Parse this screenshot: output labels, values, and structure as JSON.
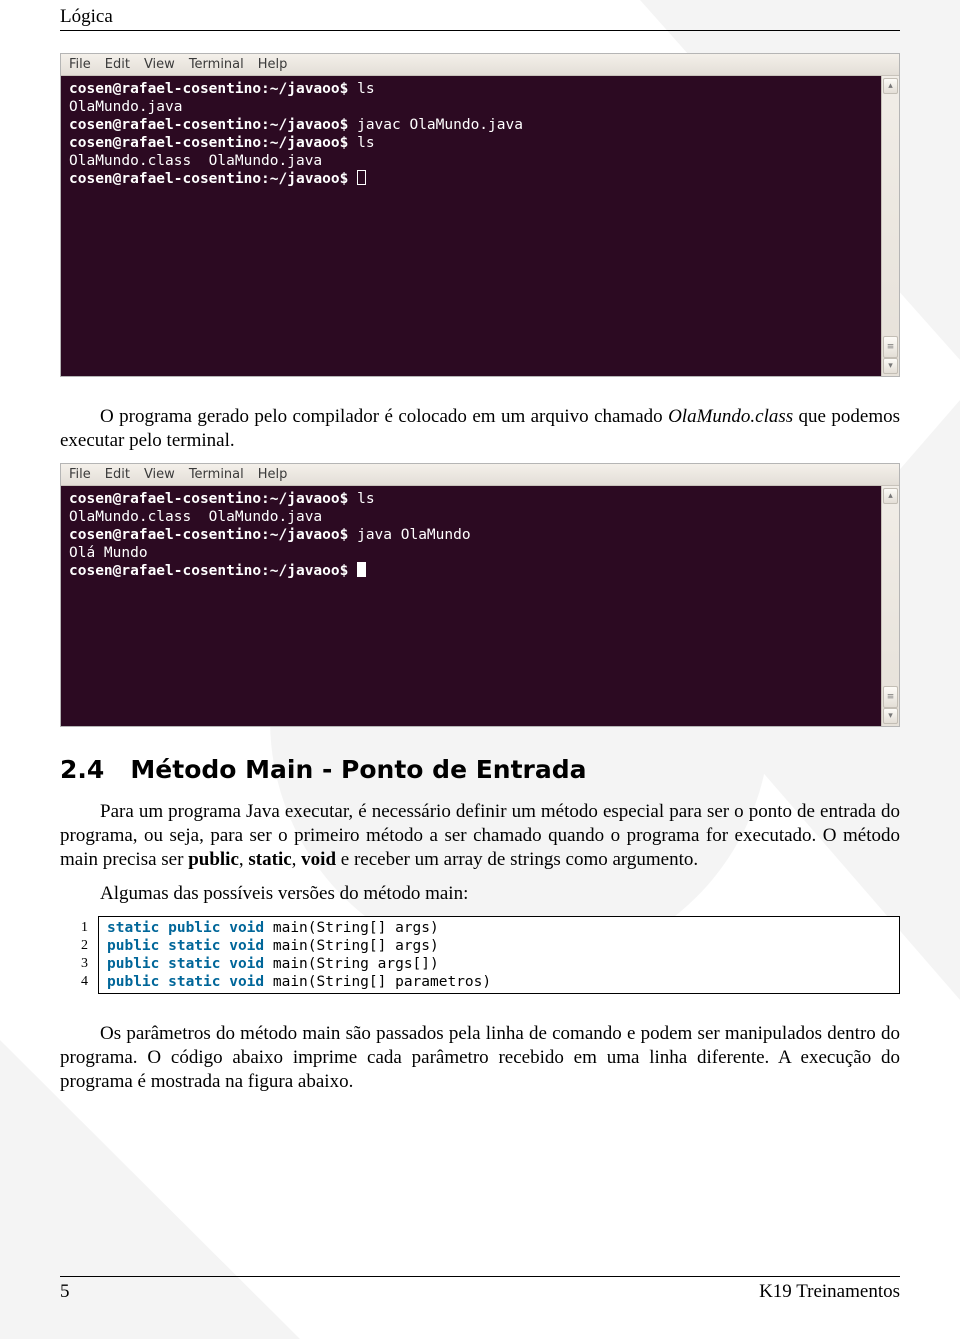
{
  "header": {
    "chapter": "Lógica"
  },
  "terminal1": {
    "menu": {
      "file": "File",
      "edit": "Edit",
      "view": "View",
      "terminal": "Terminal",
      "help": "Help"
    },
    "prompt": "cosen@rafael-cosentino:~/javaoo$",
    "l1_cmd": " ls",
    "l2": "OlaMundo.java",
    "l3_cmd": " javac OlaMundo.java",
    "l4_cmd": " ls",
    "l5": "OlaMundo.class  OlaMundo.java",
    "l6_cmd": " "
  },
  "para1": {
    "lead": "O programa gerado pelo compilador é colocado em um arquivo chamado ",
    "file": "OlaMundo.class",
    "tail": " que podemos executar pelo terminal."
  },
  "terminal2": {
    "menu": {
      "file": "File",
      "edit": "Edit",
      "view": "View",
      "terminal": "Terminal",
      "help": "Help"
    },
    "prompt": "cosen@rafael-cosentino:~/javaoo$",
    "l1_cmd": " ls",
    "l2": "OlaMundo.class  OlaMundo.java",
    "l3_cmd": " java OlaMundo",
    "l4": "Olá Mundo",
    "l5_cmd": " "
  },
  "section": {
    "number": "2.4",
    "title": "Método Main - Ponto de Entrada"
  },
  "para2": {
    "t1": "Para um programa Java executar, é necessário definir um método especial para ser o ponto de entrada do programa, ou seja, para ser o primeiro método a ser chamado quando o programa for executado. O método main precisa ser ",
    "b1": "public",
    "c1": ", ",
    "b2": "static",
    "c2": ", ",
    "b3": "void",
    "t2": " e receber um array de strings como argumento.",
    "t3": "Algumas das possíveis versões do método main:"
  },
  "code": {
    "lineno": [
      "1",
      "2",
      "3",
      "4"
    ],
    "lines": [
      {
        "pre": "",
        "kw1": "static public void",
        "rest": " main(String[] args)"
      },
      {
        "pre": "",
        "kw1": "public static void",
        "rest": " main(String[] args)"
      },
      {
        "pre": "",
        "kw1": "public static void",
        "rest": " main(String args[])"
      },
      {
        "pre": "",
        "kw1": "public static void",
        "rest": " main(String[] parametros)"
      }
    ]
  },
  "para3": "Os parâmetros do método main são passados pela linha de comando e podem ser manipulados dentro do programa. O código abaixo imprime cada parâmetro recebido em uma linha diferente. A execução do programa é mostrada na figura abaixo.",
  "footer": {
    "page": "5",
    "brand": "K19 Treinamentos"
  }
}
